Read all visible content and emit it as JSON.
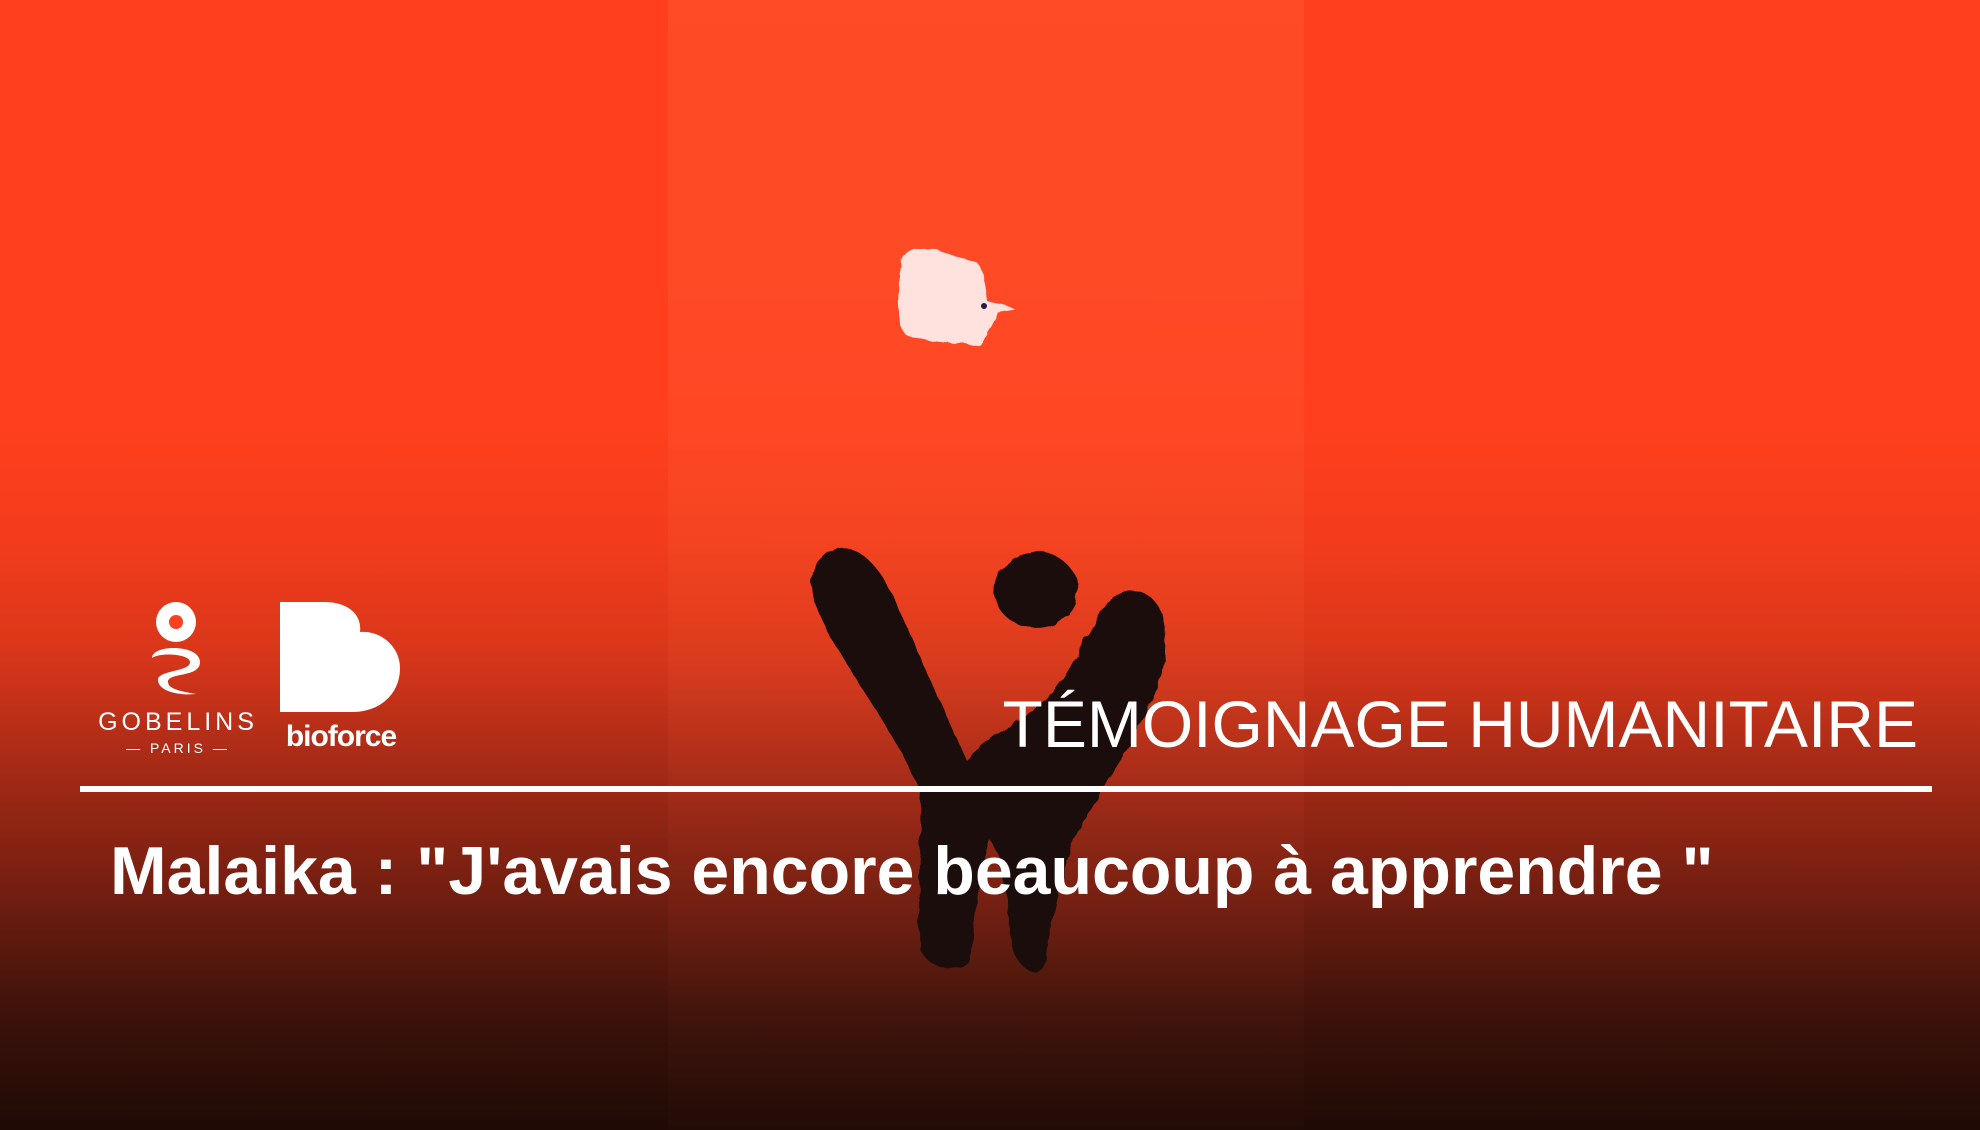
{
  "brand": {
    "partner_1_name": "GOBELINS",
    "partner_1_city": "— PARIS —",
    "partner_2_name": "bioforce"
  },
  "category_label": "TÉMOIGNAGE HUMANITAIRE",
  "headline": "Malaika : \"J'avais encore beaucoup à apprendre \"",
  "colors": {
    "background_top": "#ff3f1d",
    "background_bottom": "#1f0a06",
    "text": "#ffffff",
    "figure": "#1a0b0e",
    "bird": "#ffe1dd"
  },
  "illustration": {
    "subject_icons": [
      "bird-icon",
      "person-figure-icon"
    ]
  }
}
